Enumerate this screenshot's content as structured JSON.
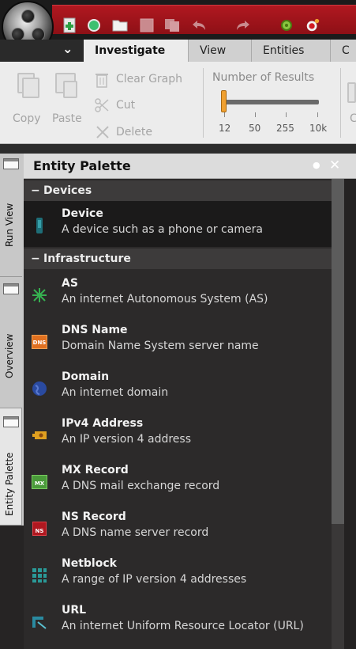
{
  "colors": {
    "toolbar_red": "#a3141c",
    "accent_orange": "#f0a030",
    "palette_bg": "#2c2a2a"
  },
  "toolbar": {
    "icons": [
      "new-graph-icon",
      "new-session-icon",
      "open-icon",
      "save-icon",
      "copy-icon",
      "undo-icon",
      "redo-icon",
      "settings-icon",
      "record-icon"
    ]
  },
  "ribbon": {
    "tabs": [
      {
        "label": "Investigate",
        "active": true
      },
      {
        "label": "View",
        "active": false
      },
      {
        "label": "Entities",
        "active": false
      },
      {
        "label": "C",
        "active": false
      }
    ],
    "copy_label": "Copy",
    "paste_label": "Paste",
    "clear_graph_label": "Clear Graph",
    "cut_label": "Cut",
    "delete_label": "Delete",
    "results_title": "Number of Results",
    "results_ticks": [
      "12",
      "50",
      "255",
      "10k"
    ],
    "results_value": "12",
    "partial_next_label": "C"
  },
  "side_tabs": [
    "Run View",
    "Overview",
    "Entity Palette"
  ],
  "palette": {
    "title": "Entity Palette",
    "categories": [
      {
        "name": "Devices",
        "items": [
          {
            "name": "Device",
            "description": "A device such as a phone or camera",
            "icon": "device-icon",
            "selected": true
          }
        ]
      },
      {
        "name": "Infrastructure",
        "items": [
          {
            "name": "AS",
            "description": "An internet Autonomous System (AS)",
            "icon": "as-icon"
          },
          {
            "name": "DNS Name",
            "description": "Domain Name System server name",
            "icon": "dns-icon",
            "badge": "DNS"
          },
          {
            "name": "Domain",
            "description": "An internet domain",
            "icon": "globe-icon"
          },
          {
            "name": "IPv4 Address",
            "description": "An IP version 4 address",
            "icon": "ip-icon"
          },
          {
            "name": "MX Record",
            "description": "A DNS mail exchange record",
            "icon": "mx-icon",
            "badge": "MX"
          },
          {
            "name": "NS Record",
            "description": "A DNS name server record",
            "icon": "ns-icon",
            "badge": "NS"
          },
          {
            "name": "Netblock",
            "description": "A range of IP version 4 addresses",
            "icon": "netblock-icon"
          },
          {
            "name": "URL",
            "description": "An internet Uniform Resource Locator (URL)",
            "icon": "url-icon"
          }
        ]
      }
    ]
  }
}
